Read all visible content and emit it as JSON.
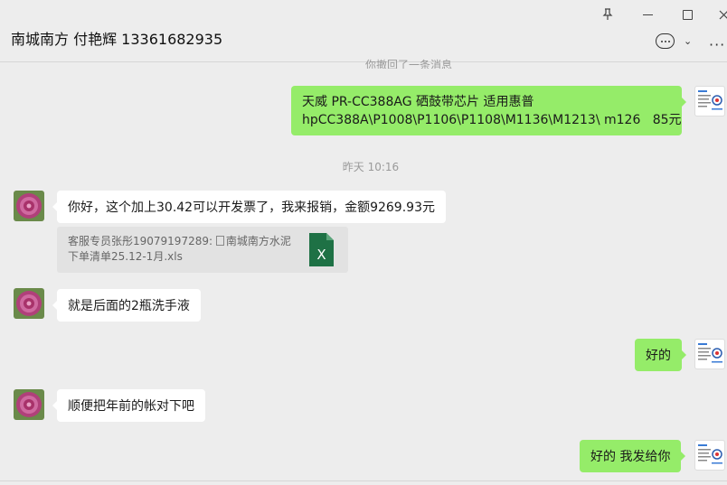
{
  "header": {
    "chat_title": "南城南方 付艳辉 13361682935",
    "window_buttons": [
      "pin-icon",
      "minimize-icon",
      "maximize-icon",
      "close-icon"
    ],
    "chat_menu_icon": "chat-bubble-icon",
    "more_icon": "more-icon"
  },
  "messages": {
    "recall_notice": "你撤回了一条消息",
    "m1": {
      "side": "right",
      "text": "天威 PR-CC388AG 硒鼓带芯片 适用惠普\nhpCC388A\\P1008\\P1106\\P1108\\M1136\\M1213\\ m126   85元"
    },
    "time1": "昨天 10:16",
    "m2": {
      "side": "left",
      "text": "你好，这个加上30.42可以开发票了，我来报销，金额9269.93元"
    },
    "quote": {
      "text": "客服专员张彤19079197289: ",
      "file": "南城南方水泥下单清单25.12-1月.xls",
      "file_icon": "excel-file-icon",
      "file_icon_letter": "X"
    },
    "m3": {
      "side": "left",
      "text": "就是后面的2瓶洗手液"
    },
    "m4": {
      "side": "right",
      "text": "好的"
    },
    "m5": {
      "side": "left",
      "text": "顺便把年前的帐对下吧"
    },
    "m6": {
      "side": "right",
      "text": "好的 我发给你"
    }
  },
  "colors": {
    "background": "#ededed",
    "outgoing_bubble": "#95ec69",
    "incoming_bubble": "#ffffff",
    "quote_bg": "#e2e2e2",
    "excel_green": "#1e7145"
  }
}
